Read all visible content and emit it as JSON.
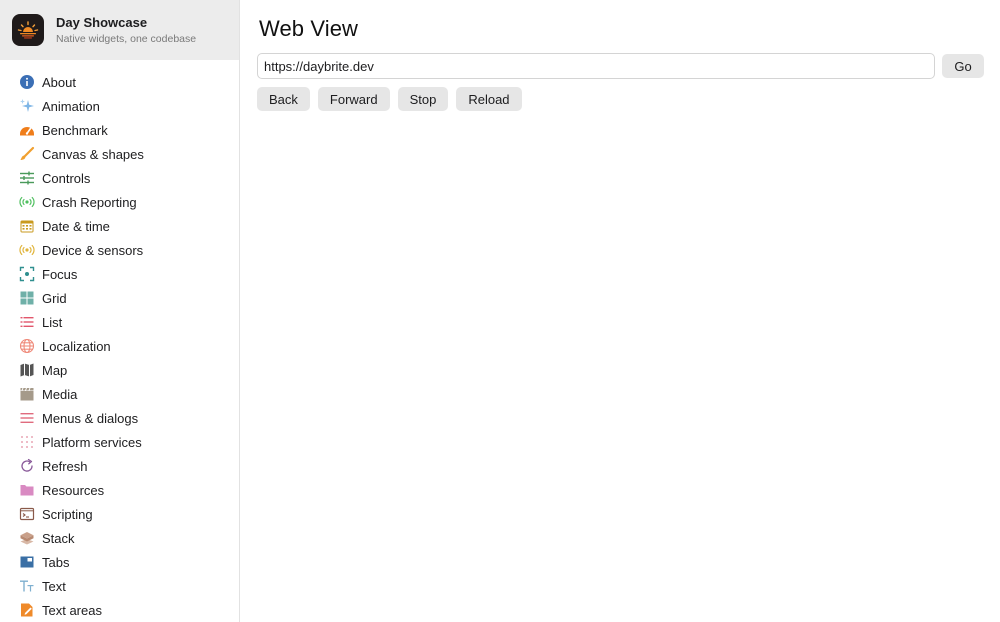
{
  "app": {
    "title": "Day Showcase",
    "subtitle": "Native widgets, one codebase",
    "logo_icon": "sunrise-icon"
  },
  "sidebar": {
    "items": [
      {
        "label": "About",
        "icon": "info-icon",
        "color": "#3b6fb5"
      },
      {
        "label": "Animation",
        "icon": "sparkle-icon",
        "color": "#7fb6e6"
      },
      {
        "label": "Benchmark",
        "icon": "speedometer-icon",
        "color": "#ef7d1a"
      },
      {
        "label": "Canvas & shapes",
        "icon": "brush-icon",
        "color": "#f0a030"
      },
      {
        "label": "Controls",
        "icon": "sliders-icon",
        "color": "#4a9a5a"
      },
      {
        "label": "Crash Reporting",
        "icon": "broadcast-icon",
        "color": "#4fbf5f"
      },
      {
        "label": "Date & time",
        "icon": "calendar-icon",
        "color": "#c99a1e"
      },
      {
        "label": "Device & sensors",
        "icon": "sensor-icon",
        "color": "#e0b43a"
      },
      {
        "label": "Focus",
        "icon": "focus-icon",
        "color": "#2f8f8f"
      },
      {
        "label": "Grid",
        "icon": "grid-icon",
        "color": "#6fb0a8"
      },
      {
        "label": "List",
        "icon": "list-icon",
        "color": "#e2566b"
      },
      {
        "label": "Localization",
        "icon": "globe-icon",
        "color": "#ef8a7a"
      },
      {
        "label": "Map",
        "icon": "map-icon",
        "color": "#555555"
      },
      {
        "label": "Media",
        "icon": "clapperboard-icon",
        "color": "#a59a8a"
      },
      {
        "label": "Menus & dialogs",
        "icon": "menu-icon",
        "color": "#e06b7e"
      },
      {
        "label": "Platform services",
        "icon": "dots-grid-icon",
        "color": "#e9a7b5"
      },
      {
        "label": "Refresh",
        "icon": "refresh-icon",
        "color": "#8a5a9a"
      },
      {
        "label": "Resources",
        "icon": "folder-icon",
        "color": "#d98ac2"
      },
      {
        "label": "Scripting",
        "icon": "terminal-icon",
        "color": "#8a5a4a"
      },
      {
        "label": "Stack",
        "icon": "layers-icon",
        "color": "#c9a08a"
      },
      {
        "label": "Tabs",
        "icon": "tabs-icon",
        "color": "#3a6fa5"
      },
      {
        "label": "Text",
        "icon": "text-icon",
        "color": "#7fb0d0"
      },
      {
        "label": "Text areas",
        "icon": "note-pencil-icon",
        "color": "#ef8a2a"
      }
    ]
  },
  "main": {
    "title": "Web View",
    "url_value": "https://daybrite.dev",
    "go_label": "Go",
    "back_label": "Back",
    "forward_label": "Forward",
    "stop_label": "Stop",
    "reload_label": "Reload"
  }
}
